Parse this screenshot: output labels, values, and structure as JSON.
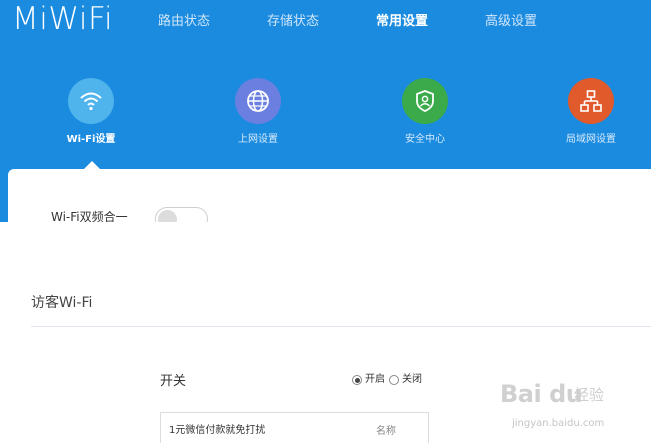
{
  "header": {
    "logo": "MiWiFi",
    "nav": [
      {
        "label": "路由状态"
      },
      {
        "label": "存储状态"
      },
      {
        "label": "常用设置",
        "active": true
      },
      {
        "label": "高级设置"
      }
    ],
    "categories": [
      {
        "label": "Wi-Fi设置",
        "icon": "wifi-icon",
        "color": "#4fb4ec",
        "active": true
      },
      {
        "label": "上网设置",
        "icon": "globe-icon",
        "color": "#6a7fe0"
      },
      {
        "label": "安全中心",
        "icon": "shield-icon",
        "color": "#3aaa4a"
      },
      {
        "label": "局域网设置",
        "icon": "network-icon",
        "color": "#e05a2b"
      }
    ],
    "background": "#1b8be0"
  },
  "wifi_dual": {
    "label": "Wi-Fi双频合一",
    "enabled": false
  },
  "guest_wifi": {
    "title": "访客Wi-Fi",
    "switch_label": "开关",
    "options": [
      {
        "label": "开启",
        "selected": true
      },
      {
        "label": "关闭",
        "selected": false
      }
    ],
    "name_value": "1元微信付款就免打扰",
    "name_suffix": "名称"
  },
  "watermark": {
    "logo": "Bai du",
    "text": "经验",
    "url": "jingyan.baidu.com"
  }
}
